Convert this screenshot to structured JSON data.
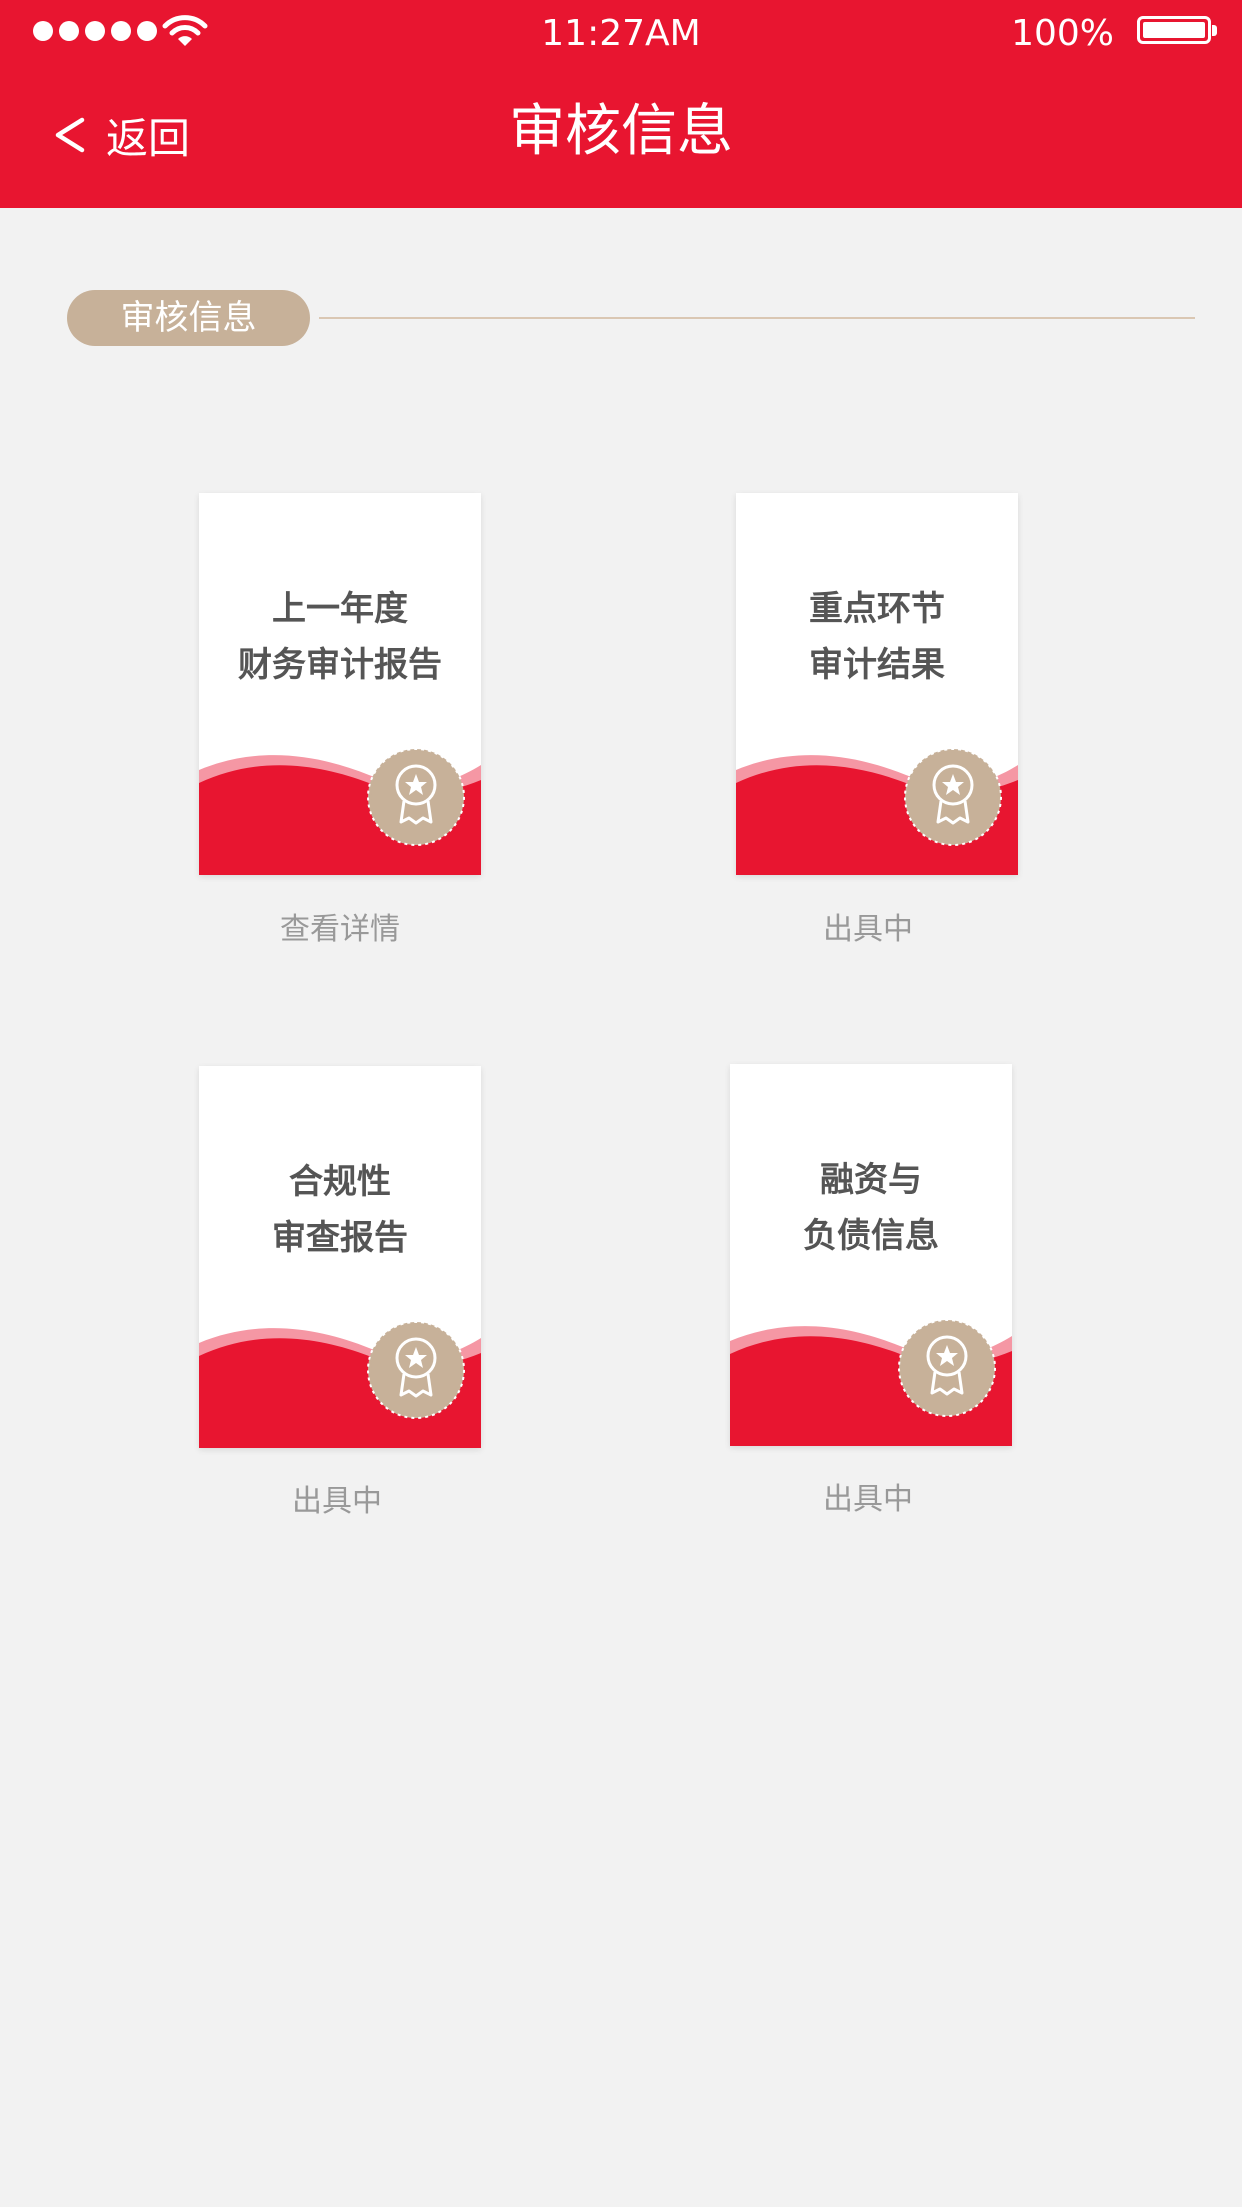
{
  "status_bar": {
    "time": "11:27AM",
    "battery": "100%"
  },
  "nav": {
    "back_label": "返回",
    "title": "审核信息"
  },
  "section": {
    "label": "审核信息"
  },
  "cards": [
    {
      "title_line1": "上一年度",
      "title_line2": "财务审计报告",
      "status": "查看详情"
    },
    {
      "title_line1": "重点环节",
      "title_line2": "审计结果",
      "status": "出具中"
    },
    {
      "title_line1": "合规性",
      "title_line2": "审查报告",
      "status": "出具中"
    },
    {
      "title_line1": "融资与",
      "title_line2": "负债信息",
      "status": "出具中"
    }
  ],
  "colors": {
    "brand_red": "#e81530",
    "accent_beige": "#c7b199",
    "background": "#f2f2f2"
  },
  "icons": [
    "signal-dots-icon",
    "wifi-icon",
    "battery-icon",
    "back-chevron-icon",
    "medal-icon"
  ]
}
